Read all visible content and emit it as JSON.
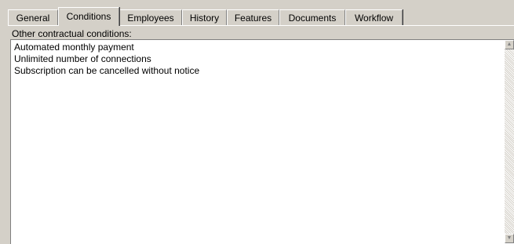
{
  "tabs": [
    {
      "label": "General",
      "active": false
    },
    {
      "label": "Conditions",
      "active": true
    },
    {
      "label": "Employees",
      "active": false
    },
    {
      "label": "History",
      "active": false
    },
    {
      "label": "Features",
      "active": false
    },
    {
      "label": "Documents",
      "active": false
    },
    {
      "label": "Workflow",
      "active": false
    }
  ],
  "conditions": {
    "label": "Other contractual conditions:",
    "lines": [
      "Automated monthly payment",
      "Unlimited number of connections",
      "Subscription can be cancelled without notice"
    ]
  },
  "scrollbar": {
    "up_icon": "arrow-up-icon",
    "down_icon": "arrow-down-icon"
  },
  "colors": {
    "window_bg": "#d4d0c8",
    "field_bg": "#ffffff"
  }
}
